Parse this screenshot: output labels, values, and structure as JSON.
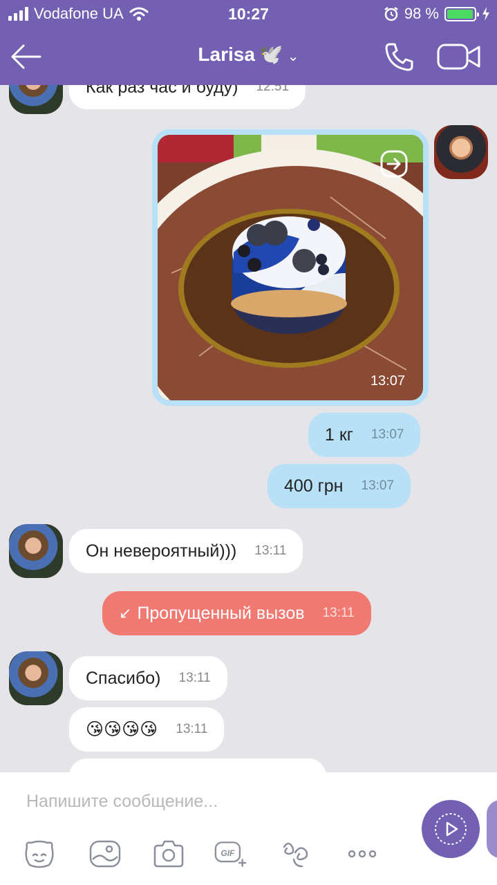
{
  "status": {
    "carrier": "Vodafone UA",
    "time": "10:27",
    "battery": "98 %",
    "battery_level": 0.98
  },
  "header": {
    "title": "Larisa",
    "emoji": "🕊️"
  },
  "messages": {
    "m0": {
      "text": "Как раз час и буду)",
      "time": "12:51"
    },
    "photo": {
      "time": "13:07"
    },
    "m1": {
      "text": "1 кг",
      "time": "13:07"
    },
    "m2": {
      "text": "400 грн",
      "time": "13:07"
    },
    "m3": {
      "text": "Он невероятный)))",
      "time": "13:11"
    },
    "missed": {
      "text": "Пропущенный вызов",
      "time": "13:11"
    },
    "m4": {
      "text": "Спасибо)",
      "time": "13:11"
    },
    "m5": {
      "text": "😘😘😘😘",
      "time": "13:11"
    }
  },
  "composer": {
    "placeholder": "Напишите сообщение..."
  },
  "colors": {
    "brand": "#7360b2",
    "outgoing": "#b8e0f6",
    "incoming": "#ffffff",
    "missed": "#f07a72",
    "background": "#e5e4e9"
  }
}
